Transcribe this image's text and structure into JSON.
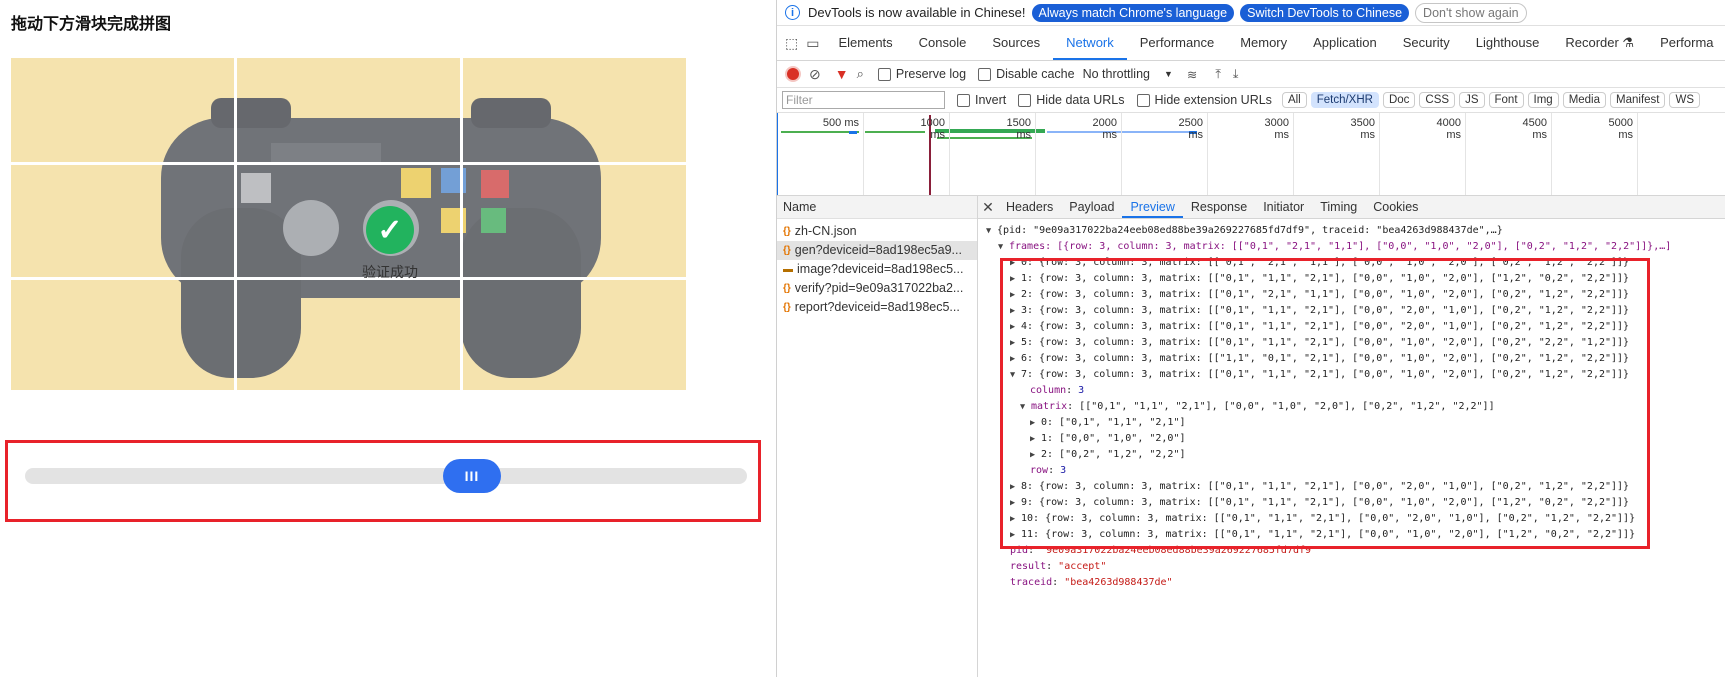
{
  "puzzle": {
    "title": "拖动下方滑块完成拼图",
    "success_text": "验证成功",
    "handle_glyph": "III"
  },
  "devtools": {
    "infobar": {
      "text": "DevTools is now available in Chinese!",
      "btn_match": "Always match Chrome's language",
      "btn_switch": "Switch DevTools to Chinese",
      "btn_dismiss": "Don't show again"
    },
    "tabs": [
      "Elements",
      "Console",
      "Sources",
      "Network",
      "Performance",
      "Memory",
      "Application",
      "Security",
      "Lighthouse",
      "Recorder ⚗",
      "Performa"
    ],
    "active_tab": "Network",
    "toolbar": {
      "preserve_log": "Preserve log",
      "disable_cache": "Disable cache",
      "throttling": "No throttling"
    },
    "filterbar": {
      "filter_placeholder": "Filter",
      "invert": "Invert",
      "hide_data_urls": "Hide data URLs",
      "hide_extension_urls": "Hide extension URLs",
      "types": [
        "All",
        "Fetch/XHR",
        "Doc",
        "CSS",
        "JS",
        "Font",
        "Img",
        "Media",
        "Manifest",
        "WS"
      ],
      "active_type": "Fetch/XHR"
    },
    "timeline_labels": [
      "500 ms",
      "1000 ms",
      "1500 ms",
      "2000 ms",
      "2500 ms",
      "3000 ms",
      "3500 ms",
      "4000 ms",
      "4500 ms",
      "5000 ms"
    ],
    "requests_header": "Name",
    "requests": [
      {
        "name": "zh-CN.json",
        "icon": "{}"
      },
      {
        "name": "gen?deviceid=8ad198ec5a9...",
        "icon": "{}"
      },
      {
        "name": "image?deviceid=8ad198ec5...",
        "icon": "▬"
      },
      {
        "name": "verify?pid=9e09a317022ba2...",
        "icon": "{}"
      },
      {
        "name": "report?deviceid=8ad198ec5...",
        "icon": "{}"
      }
    ],
    "detail_tabs": [
      "Headers",
      "Payload",
      "Preview",
      "Response",
      "Initiator",
      "Timing",
      "Cookies"
    ],
    "active_detail_tab": "Preview",
    "preview": {
      "root": "{pid: \"9e09a317022ba24eeb08ed88be39a269227685fd7df9\", traceid: \"bea4263d988437de\",…}",
      "frames_line": "frames: [{row: 3, column: 3, matrix: [[\"0,1\", \"2,1\", \"1,1\"], [\"0,0\", \"1,0\", \"2,0\"], [\"0,2\", \"1,2\", \"2,2\"]]},…]",
      "frames": [
        "0: {row: 3, column: 3, matrix: [[\"0,1\", \"2,1\", \"1,1\"], [\"0,0\", \"1,0\", \"2,0\"], [\"0,2\", \"1,2\", \"2,2\"]]}",
        "1: {row: 3, column: 3, matrix: [[\"0,1\", \"1,1\", \"2,1\"], [\"0,0\", \"1,0\", \"2,0\"], [\"1,2\", \"0,2\", \"2,2\"]]}",
        "2: {row: 3, column: 3, matrix: [[\"0,1\", \"2,1\", \"1,1\"], [\"0,0\", \"1,0\", \"2,0\"], [\"0,2\", \"1,2\", \"2,2\"]]}",
        "3: {row: 3, column: 3, matrix: [[\"0,1\", \"1,1\", \"2,1\"], [\"0,0\", \"2,0\", \"1,0\"], [\"0,2\", \"1,2\", \"2,2\"]]}",
        "4: {row: 3, column: 3, matrix: [[\"0,1\", \"1,1\", \"2,1\"], [\"0,0\", \"2,0\", \"1,0\"], [\"0,2\", \"1,2\", \"2,2\"]]}",
        "5: {row: 3, column: 3, matrix: [[\"0,1\", \"1,1\", \"2,1\"], [\"0,0\", \"1,0\", \"2,0\"], [\"0,2\", \"2,2\", \"1,2\"]]}",
        "6: {row: 3, column: 3, matrix: [[\"1,1\", \"0,1\", \"2,1\"], [\"0,0\", \"1,0\", \"2,0\"], [\"0,2\", \"1,2\", \"2,2\"]]}",
        "7: {row: 3, column: 3, matrix: [[\"0,1\", \"1,1\", \"2,1\"], [\"0,0\", \"1,0\", \"2,0\"], [\"0,2\", \"1,2\", \"2,2\"]]}"
      ],
      "expanded_column": "3",
      "expanded_matrix": "[[\"0,1\", \"1,1\", \"2,1\"], [\"0,0\", \"1,0\", \"2,0\"], [\"0,2\", \"1,2\", \"2,2\"]]",
      "matrix_rows": [
        "0: [\"0,1\", \"1,1\", \"2,1\"]",
        "1: [\"0,0\", \"1,0\", \"2,0\"]",
        "2: [\"0,2\", \"1,2\", \"2,2\"]"
      ],
      "expanded_row": "3",
      "frames_rest": [
        "8: {row: 3, column: 3, matrix: [[\"0,1\", \"1,1\", \"2,1\"], [\"0,0\", \"2,0\", \"1,0\"], [\"0,2\", \"1,2\", \"2,2\"]]}",
        "9: {row: 3, column: 3, matrix: [[\"0,1\", \"1,1\", \"2,1\"], [\"0,0\", \"1,0\", \"2,0\"], [\"1,2\", \"0,2\", \"2,2\"]]}",
        "10: {row: 3, column: 3, matrix: [[\"0,1\", \"1,1\", \"2,1\"], [\"0,0\", \"2,0\", \"1,0\"], [\"0,2\", \"1,2\", \"2,2\"]]}",
        "11: {row: 3, column: 3, matrix: [[\"0,1\", \"1,1\", \"2,1\"], [\"0,0\", \"1,0\", \"2,0\"], [\"1,2\", \"0,2\", \"2,2\"]]}"
      ],
      "pid": "\"9e09a317022ba24eeb08ed88be39a269227685fd7df9\"",
      "result": "\"accept\"",
      "traceid": "\"bea4263d988437de\""
    }
  },
  "colors": {
    "accent": "#1a73e8",
    "highlight": "#e8222a",
    "slider_handle": "#2f6ff0",
    "success": "#22b35e",
    "puzzle_bg": "#f1d68c"
  }
}
